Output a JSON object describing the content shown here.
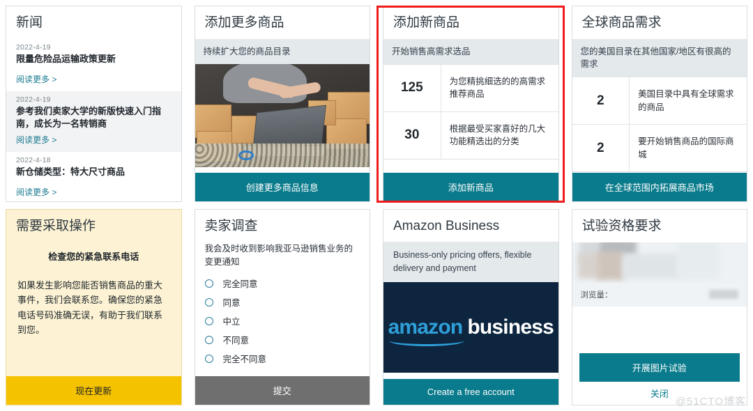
{
  "news_card": {
    "title": "新闻",
    "items": [
      {
        "date": "2022-4-19",
        "headline": "限量危险品运输政策更新",
        "link": "阅读更多 >"
      },
      {
        "date": "2022-4-19",
        "headline": "参考我们卖家大学的新版快速入门指南，成长为一名转销商",
        "link": "阅读更多 >"
      },
      {
        "date": "2022-4-18",
        "headline": "新仓储类型：特大尺寸商品",
        "link": "阅读更多 >"
      }
    ]
  },
  "add_more_products": {
    "title": "添加更多商品",
    "subtitle": "持续扩大您的商品目录",
    "image_alt": "packing-boxes-laptop-photo",
    "button": "创建更多商品信息"
  },
  "add_new_products": {
    "title": "添加新商品",
    "subtitle": "开始销售高需求选品",
    "rows": [
      {
        "value": "125",
        "text": "为您精挑细选的的高需求推荐商品"
      },
      {
        "value": "30",
        "text": "根据最受买家喜好的几大功能精选出的分类"
      }
    ],
    "button": "添加新商品",
    "highlighted": true,
    "highlight_color": "#ef1a1a"
  },
  "global_demand": {
    "title": "全球商品需求",
    "subtitle": "您的美国目录在其他国家/地区有很高的需求",
    "rows": [
      {
        "value": "2",
        "text": "美国目录中具有全球需求的商品"
      },
      {
        "value": "2",
        "text": "要开始销售商品的国际商城"
      }
    ],
    "button": "在全球范围内拓展商品市场"
  },
  "action_required": {
    "title": "需要采取操作",
    "subtitle": "检查您的紧急联系电话",
    "body": "如果发生影响您能否销售商品的重大事件，我们会联系您。确保您的紧急电话号码准确无误，有助于我们联系到您。",
    "button": "现在更新"
  },
  "seller_survey": {
    "title": "卖家调查",
    "question": "我会及时收到影响我亚马逊销售业务的变更通知",
    "options": [
      "完全同意",
      "同意",
      "中立",
      "不同意",
      "完全不同意"
    ],
    "selected": null,
    "button": "提交"
  },
  "amazon_business": {
    "title": "Amazon Business",
    "subtitle": "Business-only pricing offers, flexible delivery and payment",
    "logo_primary": "amazon",
    "logo_secondary": "business",
    "button": "Create a free account"
  },
  "trial_requirements": {
    "title": "试验资格要求",
    "views_label": "浏览量：",
    "views_value": "",
    "primary_button": "开展图片试验",
    "secondary_button": "关闭"
  },
  "watermark": "@51CTO博客",
  "colors": {
    "teal": "#0a7b8c",
    "amber": "#f5c200",
    "gray": "#6f6f6f",
    "subbar": "#e4e9ec",
    "highlight_red": "#ef1a1a",
    "link_blue": "#1c7b91"
  }
}
